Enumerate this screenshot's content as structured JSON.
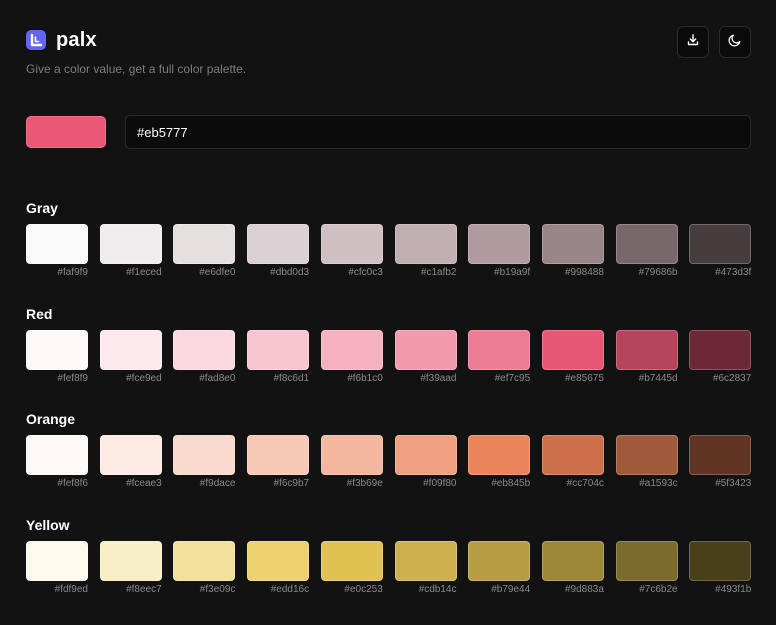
{
  "app": {
    "title": "palx",
    "tagline": "Give a color value, get a full color palette."
  },
  "toolbar": {
    "download_icon": "download-icon",
    "theme_icon": "moon-icon"
  },
  "input": {
    "value": "#eb5777",
    "preview_color": "#eb5777"
  },
  "palettes": [
    {
      "name": "Gray",
      "colors": [
        "#faf9f9",
        "#f1eced",
        "#e6dfe0",
        "#dbd0d3",
        "#cfc0c3",
        "#c1afb2",
        "#b19a9f",
        "#998488",
        "#79686b",
        "#473d3f"
      ]
    },
    {
      "name": "Red",
      "colors": [
        "#fef8f9",
        "#fce9ed",
        "#fad8e0",
        "#f8c6d1",
        "#f6b1c0",
        "#f39aad",
        "#ef7c95",
        "#e85675",
        "#b7445d",
        "#6c2837"
      ]
    },
    {
      "name": "Orange",
      "colors": [
        "#fef8f6",
        "#fceae3",
        "#f9dace",
        "#f6c9b7",
        "#f3b69e",
        "#f09f80",
        "#eb845b",
        "#cc704c",
        "#a1593c",
        "#5f3423"
      ]
    },
    {
      "name": "Yellow",
      "colors": [
        "#fdf9ed",
        "#f8eec7",
        "#f3e09c",
        "#edd16c",
        "#e0c253",
        "#cdb14c",
        "#b79e44",
        "#9d883a",
        "#7c6b2e",
        "#493f1b"
      ]
    }
  ]
}
